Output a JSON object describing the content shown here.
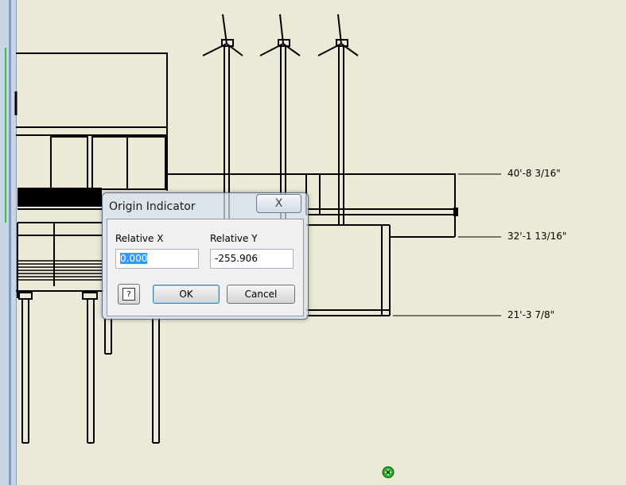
{
  "elevations": [
    {
      "text": "40'-8 3/16\""
    },
    {
      "text": "32'-1 13/16\""
    },
    {
      "text": "21'-3 7/8\""
    }
  ],
  "dialog": {
    "title": "Origin Indicator",
    "close_glyph": "X",
    "relative_x_label": "Relative X",
    "relative_x_value": "0.000",
    "relative_y_label": "Relative Y",
    "relative_y_value": "-255.906",
    "help_glyph": "?",
    "ok_label": "OK",
    "cancel_label": "Cancel"
  },
  "icons": {
    "help": "help-icon",
    "close": "close-icon",
    "origin": "origin-indicator-icon"
  },
  "colors": {
    "canvas": "#ecead6",
    "origin_marker": "#2eaa2e",
    "selection": "#3399ff"
  }
}
